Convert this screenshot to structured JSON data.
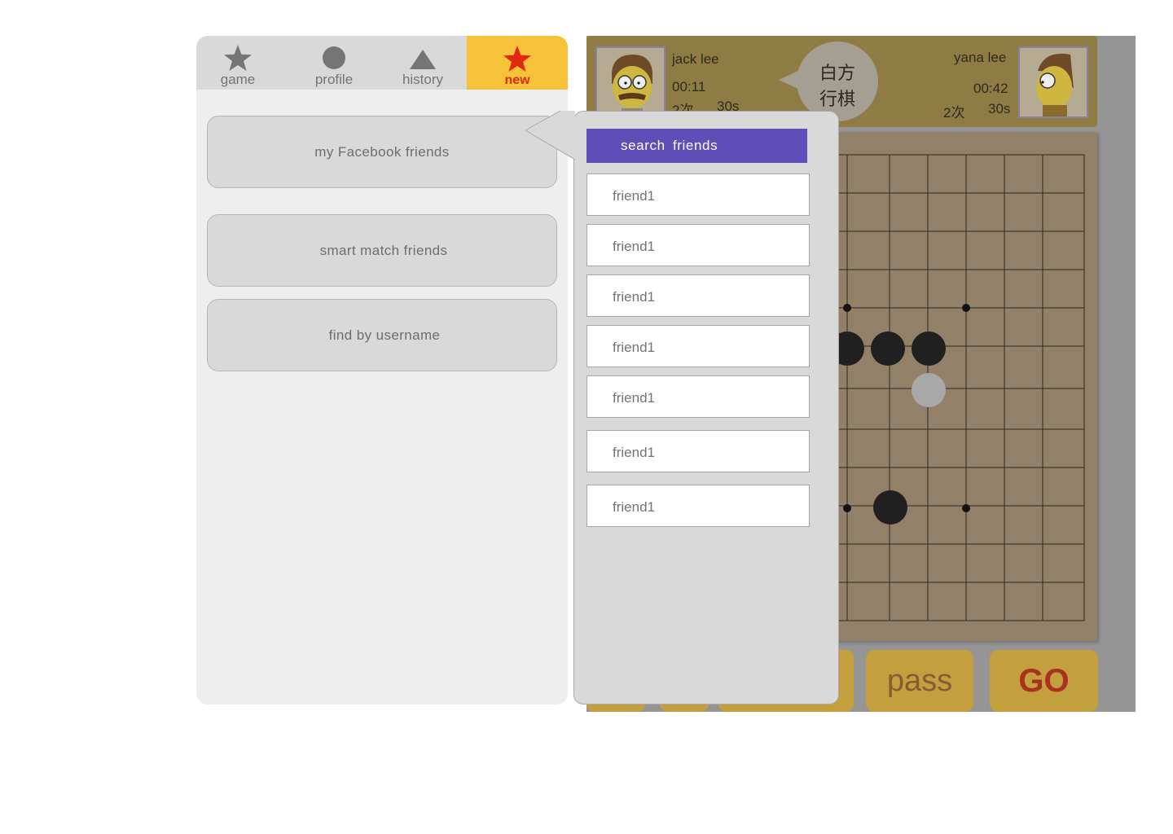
{
  "tabs": [
    {
      "label": "game",
      "icon": "star-icon"
    },
    {
      "label": "profile",
      "icon": "circle-icon"
    },
    {
      "label": "history",
      "icon": "triangle-icon"
    },
    {
      "label": "new",
      "icon": "star-icon",
      "active": true
    }
  ],
  "options": {
    "facebook": "my Facebook friends",
    "smart_match": "smart match friends",
    "find_username": "find by username"
  },
  "players": {
    "left": {
      "name": "jack lee",
      "time": "00:11",
      "count": "2次",
      "seconds": "30s"
    },
    "right": {
      "name": "yana lee",
      "time": "00:42",
      "count": "2次",
      "seconds": "30s"
    }
  },
  "turn_bubble": {
    "line1": "白方",
    "line2": "行棋"
  },
  "controls": {
    "pass": "pass",
    "go": "GO"
  },
  "popover": {
    "search_label": "search  friends",
    "friends": [
      "friend1",
      "friend1",
      "friend1",
      "friend1",
      "friend1",
      "friend1",
      "friend1"
    ]
  },
  "colors": {
    "accent_tab": "#f5c23a",
    "accent_tab_text": "#e0290e",
    "search_button": "#5f4db8",
    "board": "#938068",
    "player_bar": "#8e7c44",
    "action_button": "#c39f3e"
  }
}
